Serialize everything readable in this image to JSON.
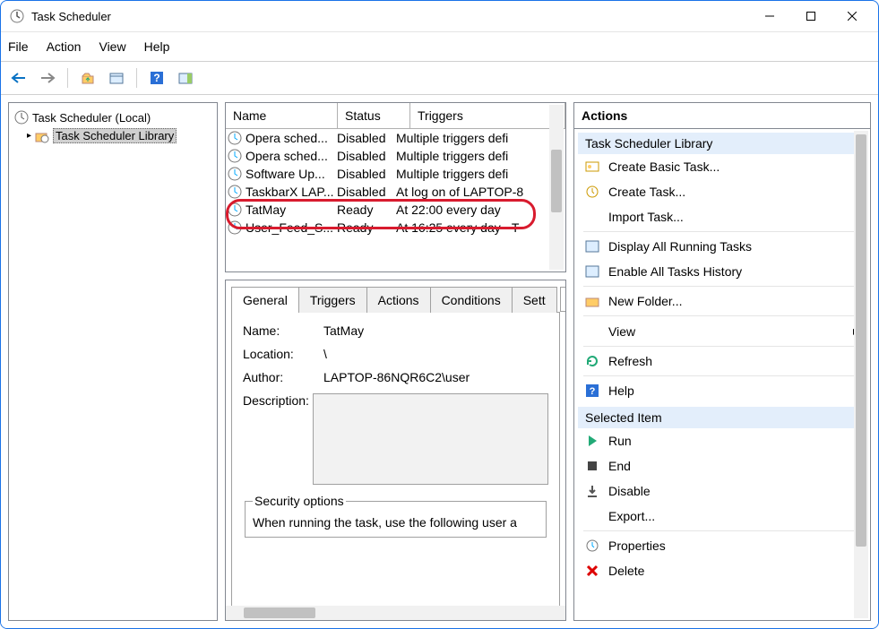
{
  "title": "Task Scheduler",
  "menu": [
    "File",
    "Action",
    "View",
    "Help"
  ],
  "nav": {
    "root": "Task Scheduler (Local)",
    "child": "Task Scheduler Library"
  },
  "tasks": {
    "cols": [
      "Name",
      "Status",
      "Triggers"
    ],
    "rows": [
      {
        "name": "Opera sched...",
        "status": "Disabled",
        "trigger": "Multiple triggers defi"
      },
      {
        "name": "Opera sched...",
        "status": "Disabled",
        "trigger": "Multiple triggers defi"
      },
      {
        "name": "Software Up...",
        "status": "Disabled",
        "trigger": "Multiple triggers defi"
      },
      {
        "name": "TaskbarX LAP...",
        "status": "Disabled",
        "trigger": "At log on of LAPTOP-8"
      },
      {
        "name": "TatMay",
        "status": "Ready",
        "trigger": "At 22:00 every day"
      },
      {
        "name": "User_Feed_S...",
        "status": "Ready",
        "trigger": "At 16:25 every day - T"
      }
    ]
  },
  "tabs": [
    "General",
    "Triggers",
    "Actions",
    "Conditions",
    "Sett"
  ],
  "general": {
    "lab_name": "Name:",
    "name": "TatMay",
    "lab_location": "Location:",
    "location": "\\",
    "lab_author": "Author:",
    "author": "LAPTOP-86NQR6C2\\user",
    "lab_description": "Description:",
    "sec_header": "Security options",
    "sec_line": "When running the task, use the following user a"
  },
  "actions": {
    "title": "Actions",
    "group1": "Task Scheduler Library",
    "items1": [
      "Create Basic Task...",
      "Create Task...",
      "Import Task...",
      "Display All Running Tasks",
      "Enable All Tasks History",
      "New Folder...",
      "View",
      "Refresh",
      "Help"
    ],
    "group2": "Selected Item",
    "items2": [
      "Run",
      "End",
      "Disable",
      "Export...",
      "Properties",
      "Delete"
    ]
  }
}
